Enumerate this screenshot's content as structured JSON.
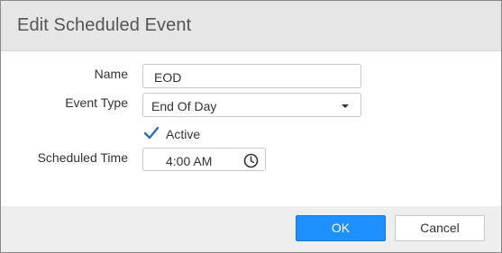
{
  "dialog": {
    "title": "Edit Scheduled Event"
  },
  "form": {
    "name_label": "Name",
    "name_value": "EOD",
    "event_type_label": "Event Type",
    "event_type_value": "End Of Day",
    "active_label": "Active",
    "active_checked": true,
    "scheduled_time_label": "Scheduled Time",
    "scheduled_time_value": "4:00 AM"
  },
  "footer": {
    "ok_label": "OK",
    "cancel_label": "Cancel"
  },
  "icons": {
    "event_type_dropdown": "chevron-down-icon",
    "active": "checkmark-icon",
    "scheduled_time": "clock-icon"
  },
  "colors": {
    "header_bg": "#e6e6e6",
    "footer_bg": "#eeeeee",
    "primary_button": "#1e90ff",
    "check_color": "#2a6ebb"
  }
}
